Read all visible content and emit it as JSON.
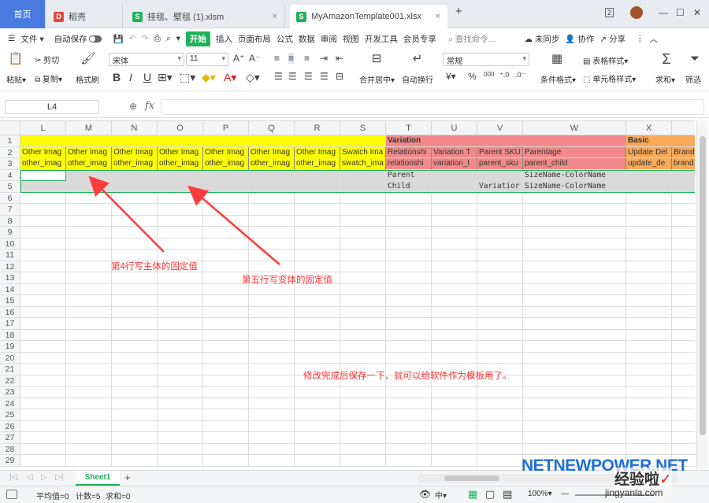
{
  "tabbar": {
    "home": "首页",
    "tabs": [
      {
        "label": "稻壳"
      },
      {
        "label": "挂毯、壁毯 (1).xlsm"
      },
      {
        "label": "MyAmazonTemplate001.xlsx"
      }
    ],
    "add": "+",
    "badge": "2"
  },
  "menubar": {
    "file": "文件",
    "autosave": "自动保存",
    "start": "开始",
    "items": [
      "插入",
      "页面布局",
      "公式",
      "数据",
      "审阅",
      "视图",
      "开发工具",
      "会员专享"
    ],
    "search_placeholder": "查找命令...",
    "unsync": "未同步",
    "collab": "协作",
    "share": "分享"
  },
  "ribbon": {
    "paste": "粘贴",
    "cut": "剪切",
    "copy": "复制",
    "format_painter": "格式刷",
    "font_name": "宋体",
    "font_size": "11",
    "merge_center": "合并居中",
    "wrap": "自动换行",
    "number_format": "常规",
    "cond_format": "条件格式",
    "table_style": "表格样式",
    "cell_style": "单元格样式",
    "sum": "求和",
    "filter": "筛选",
    "percent": "%",
    "thousands": "000",
    "bold": "B",
    "italic": "I",
    "underline": "U"
  },
  "formula": {
    "cell_ref": "L4",
    "fx": "fx",
    "value": ""
  },
  "grid": {
    "columns": [
      "L",
      "M",
      "N",
      "O",
      "P",
      "Q",
      "R",
      "S",
      "T",
      "U",
      "V",
      "W",
      "X",
      ""
    ],
    "rows": [
      "1",
      "2",
      "3",
      "4",
      "5",
      "6",
      "7",
      "8",
      "9",
      "10",
      "11",
      "12",
      "13",
      "14",
      "15",
      "16",
      "17",
      "18",
      "19",
      "20",
      "21",
      "22",
      "23",
      "24",
      "25",
      "26",
      "27",
      "28",
      "29"
    ],
    "row1": {
      "T": "Variation",
      "X": "Basic"
    },
    "row2": [
      "Other Imag",
      "Other Imag",
      "Other Imag",
      "Other Imag",
      "Other Imag",
      "Other Imag",
      "Other Imag",
      "Swatch Ima",
      "Relationshi",
      "Variation T",
      "Parent SKU",
      "Parentage",
      "Update Del",
      "Brand"
    ],
    "row3": [
      "other_imag",
      "other_imag",
      "other_imag",
      "other_imag",
      "other_imag",
      "other_imag",
      "other_imag",
      "swatch_ima",
      "relationshi",
      "variation_t",
      "parent_sku",
      "parent_child",
      "update_de",
      "brand"
    ],
    "row4": {
      "T": "Parent",
      "W": "SizeName-ColorName"
    },
    "row5": {
      "T": "Child",
      "V": "Variatior",
      "W": "SizeName-ColorName"
    }
  },
  "annotations": {
    "a1": "第4行写主体的固定值",
    "a2": "第五行写变体的固定值",
    "a3": "修改完成后保存一下，就可以给软件作为模板用了。"
  },
  "sheets": {
    "active": "Sheet1",
    "add": "+"
  },
  "status": {
    "avg": "平均值=0",
    "count": "计数=5",
    "sum": "求和=0",
    "zoom": "100%"
  },
  "watermark": {
    "w1": "NETNEWPOWER.NET",
    "w2": "经验啦",
    "w3": "jingyanla.com"
  },
  "colors": {
    "yellow": "#ffff00",
    "red": "#f3898a",
    "orange": "#f8a959",
    "grey": "#d9d9d9",
    "accent": "#1fb25a",
    "home": "#4a7be0"
  }
}
